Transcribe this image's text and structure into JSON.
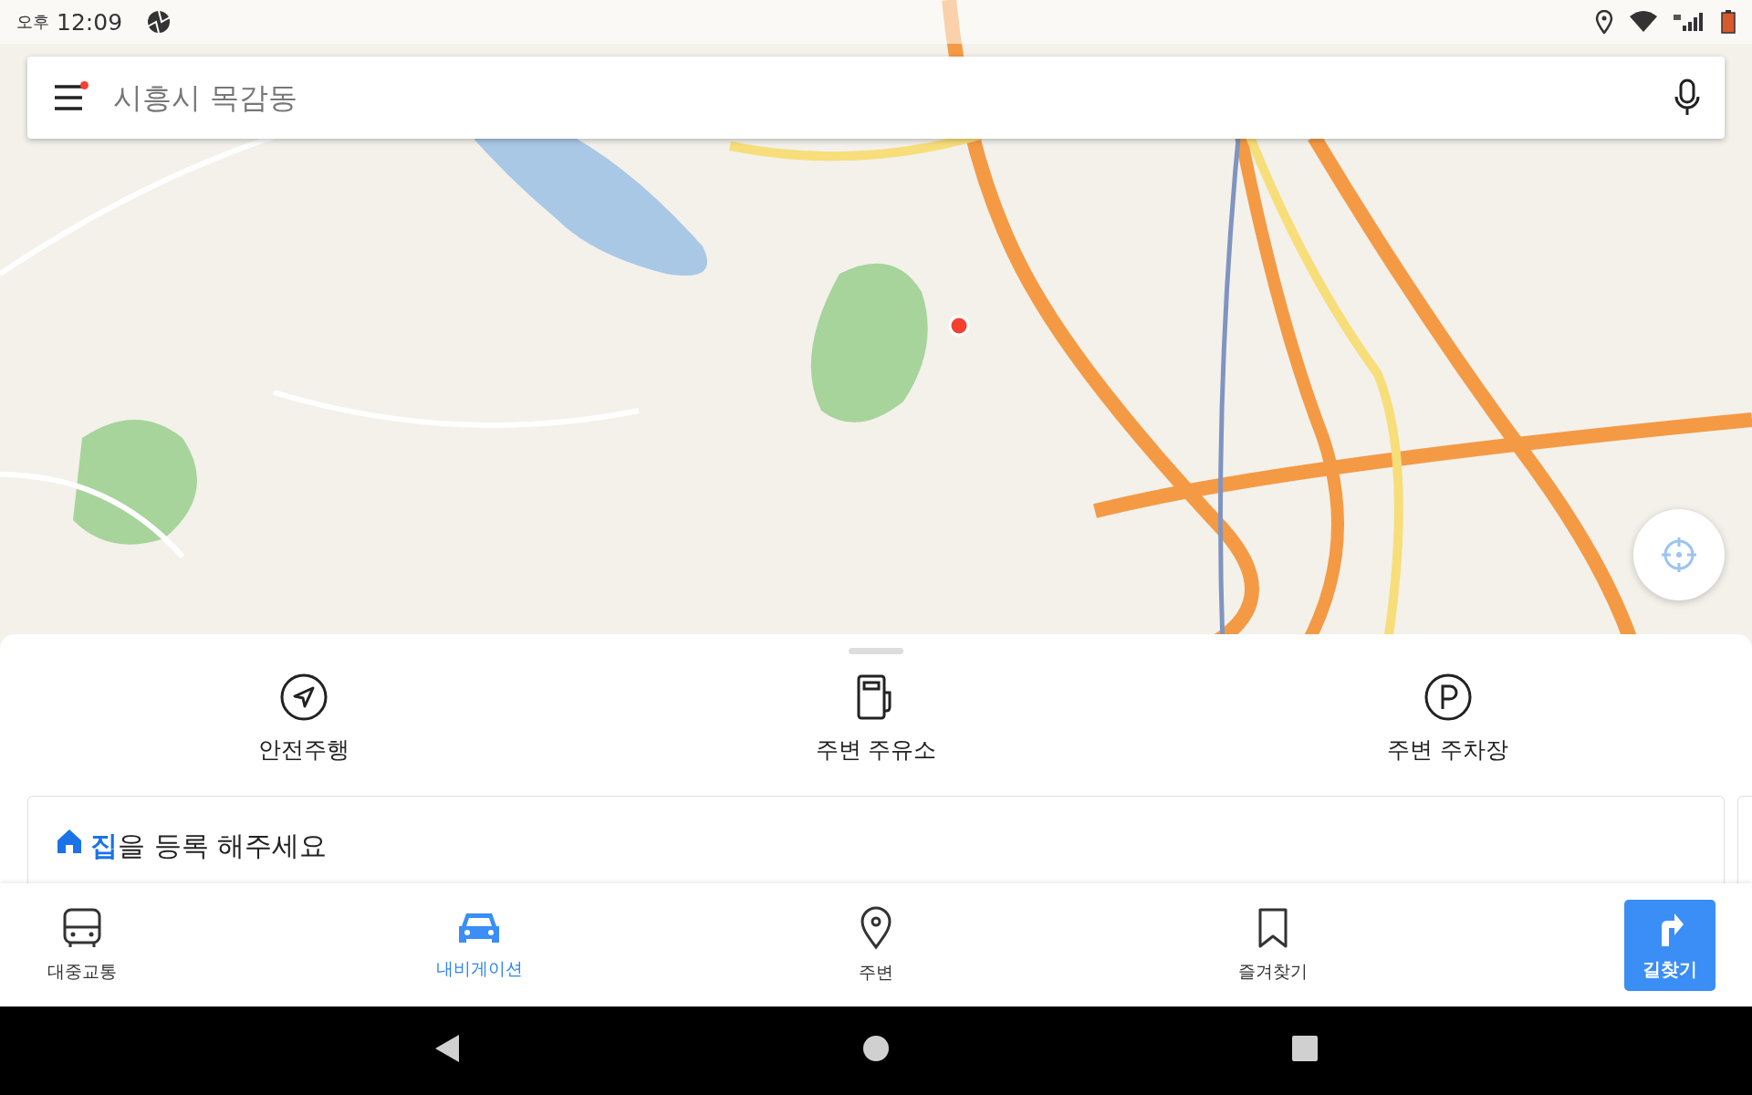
{
  "status_bar": {
    "ampm": "오후",
    "time": "12:09"
  },
  "search": {
    "placeholder": "시흥시 목감동",
    "menu_notification": true
  },
  "quick_actions": [
    {
      "label": "안전주행"
    },
    {
      "label": "주변 주유소"
    },
    {
      "label": "주변 주차장"
    }
  ],
  "home_card": {
    "text": "**집**을 등록 해주세요"
  },
  "bottom_nav": [
    {
      "kind": "tab",
      "label": "대중교통",
      "selected": false
    },
    {
      "kind": "tab",
      "label": "내비게이션",
      "selected": true
    },
    {
      "kind": "tab",
      "label": "주변",
      "selected": false
    },
    {
      "kind": "tab",
      "label": "즐겨찾기",
      "selected": false
    },
    {
      "kind": "primary",
      "label": "길찾기"
    }
  ]
}
